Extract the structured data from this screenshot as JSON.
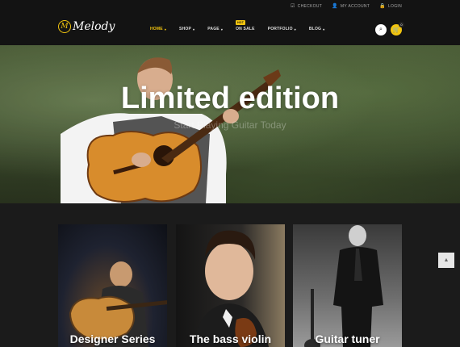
{
  "topbar": {
    "links": [
      {
        "icon": "checkout-icon",
        "glyph": "☑",
        "label": "CHECKOUT"
      },
      {
        "icon": "user-icon",
        "glyph": "👤",
        "label": "MY ACCOUNT"
      },
      {
        "icon": "lock-icon",
        "glyph": "🔒",
        "label": "LOGIN"
      }
    ]
  },
  "nav": {
    "logo_mark": "M",
    "logo_text": "Melody",
    "items": [
      {
        "label": "HOME",
        "has_chevron": true,
        "active": true,
        "tag": ""
      },
      {
        "label": "SHOP",
        "has_chevron": true,
        "active": false,
        "tag": ""
      },
      {
        "label": "PAGE",
        "has_chevron": true,
        "active": false,
        "tag": ""
      },
      {
        "label": "ON SALE",
        "has_chevron": false,
        "active": false,
        "tag": "HOT"
      },
      {
        "label": "PORTFOLIO",
        "has_chevron": true,
        "active": false,
        "tag": ""
      },
      {
        "label": "BLOG",
        "has_chevron": true,
        "active": false,
        "tag": ""
      }
    ],
    "cart_count": "0",
    "accent": "#f1c40f"
  },
  "hero": {
    "headline": "Limited edition",
    "subheadline": "Start Playing Guitar Today"
  },
  "cards": [
    {
      "title": "Designer Series"
    },
    {
      "title": "The bass violin"
    },
    {
      "title": "Guitar tuner"
    }
  ]
}
